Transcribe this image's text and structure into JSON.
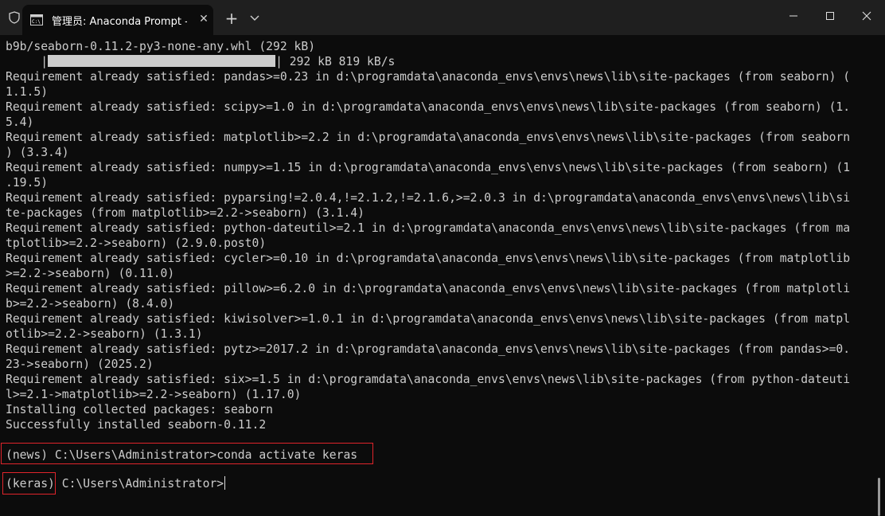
{
  "titlebar": {
    "tab_title": "管理员: Anaconda Prompt - co",
    "new_tab_symbol": "+"
  },
  "console": {
    "lines": [
      "b9b/seaborn-0.11.2-py3-none-any.whl (292 kB)",
      "__PROGRESS__",
      "Requirement already satisfied: pandas>=0.23 in d:\\programdata\\anaconda_envs\\envs\\news\\lib\\site-packages (from seaborn) (",
      "1.1.5)",
      "Requirement already satisfied: scipy>=1.0 in d:\\programdata\\anaconda_envs\\envs\\news\\lib\\site-packages (from seaborn) (1.",
      "5.4)",
      "Requirement already satisfied: matplotlib>=2.2 in d:\\programdata\\anaconda_envs\\envs\\news\\lib\\site-packages (from seaborn",
      ") (3.3.4)",
      "Requirement already satisfied: numpy>=1.15 in d:\\programdata\\anaconda_envs\\envs\\news\\lib\\site-packages (from seaborn) (1",
      ".19.5)",
      "Requirement already satisfied: pyparsing!=2.0.4,!=2.1.2,!=2.1.6,>=2.0.3 in d:\\programdata\\anaconda_envs\\envs\\news\\lib\\si",
      "te-packages (from matplotlib>=2.2->seaborn) (3.1.4)",
      "Requirement already satisfied: python-dateutil>=2.1 in d:\\programdata\\anaconda_envs\\envs\\news\\lib\\site-packages (from ma",
      "tplotlib>=2.2->seaborn) (2.9.0.post0)",
      "Requirement already satisfied: cycler>=0.10 in d:\\programdata\\anaconda_envs\\envs\\news\\lib\\site-packages (from matplotlib",
      ">=2.2->seaborn) (0.11.0)",
      "Requirement already satisfied: pillow>=6.2.0 in d:\\programdata\\anaconda_envs\\envs\\news\\lib\\site-packages (from matplotli",
      "b>=2.2->seaborn) (8.4.0)",
      "Requirement already satisfied: kiwisolver>=1.0.1 in d:\\programdata\\anaconda_envs\\envs\\news\\lib\\site-packages (from matpl",
      "otlib>=2.2->seaborn) (1.3.1)",
      "Requirement already satisfied: pytz>=2017.2 in d:\\programdata\\anaconda_envs\\envs\\news\\lib\\site-packages (from pandas>=0.",
      "23->seaborn) (2025.2)",
      "Requirement already satisfied: six>=1.5 in d:\\programdata\\anaconda_envs\\envs\\news\\lib\\site-packages (from python-dateuti",
      "l>=2.1->matplotlib>=2.2->seaborn) (1.17.0)",
      "Installing collected packages: seaborn",
      "Successfully installed seaborn-0.11.2",
      "",
      "(news) C:\\Users\\Administrator>conda activate keras",
      ""
    ],
    "progress_prefix": "     |",
    "progress_suffix": "| 292 kB 819 kB/s",
    "progress_fraction": 1.0,
    "prompt_env": "(keras)",
    "prompt_path": " C:\\Users\\Administrator>"
  },
  "colors": {
    "background": "#0c0c0c",
    "text": "#cccccc",
    "highlight": "#e0242b"
  }
}
